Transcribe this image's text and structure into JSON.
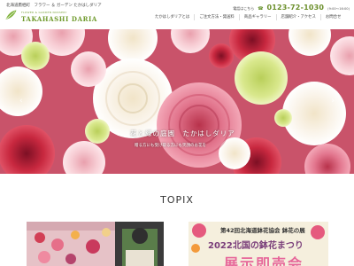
{
  "header": {
    "tagline": "北海道鷹栖町　フラワー ＆ ガーデン たかはしダリア",
    "logo_sub": "FLOWER & GARDEN NURSERY",
    "logo_main": "TAKAHASHI DARIA",
    "nav": [
      "たかはしダリアとは",
      "ご注文方法・発送料",
      "商品ギャラリー",
      "店舗紹介・アクセス",
      "お問合せ"
    ],
    "contact_label": "電話はこちら",
    "phone": "0123-72-1030",
    "hours": "(9:00～16:00)"
  },
  "hero": {
    "caption": "花と緑の庭園　たかはしダリア",
    "sub": "贈る方にも受け取る方にも笑顔のお花を",
    "prev_arrow": "‹",
    "next_arrow": "›"
  },
  "topix": {
    "title": "TOPIX",
    "cards": [
      {
        "kind": "photo"
      },
      {
        "line1": "第42回北海道鉢花協会 鉢花の展",
        "line2": "2022北国の鉢花まつり",
        "line3": "展示即売会"
      }
    ]
  },
  "colors": {
    "brand_green": "#6f9a2c",
    "hero_pink": "#e2758d"
  }
}
